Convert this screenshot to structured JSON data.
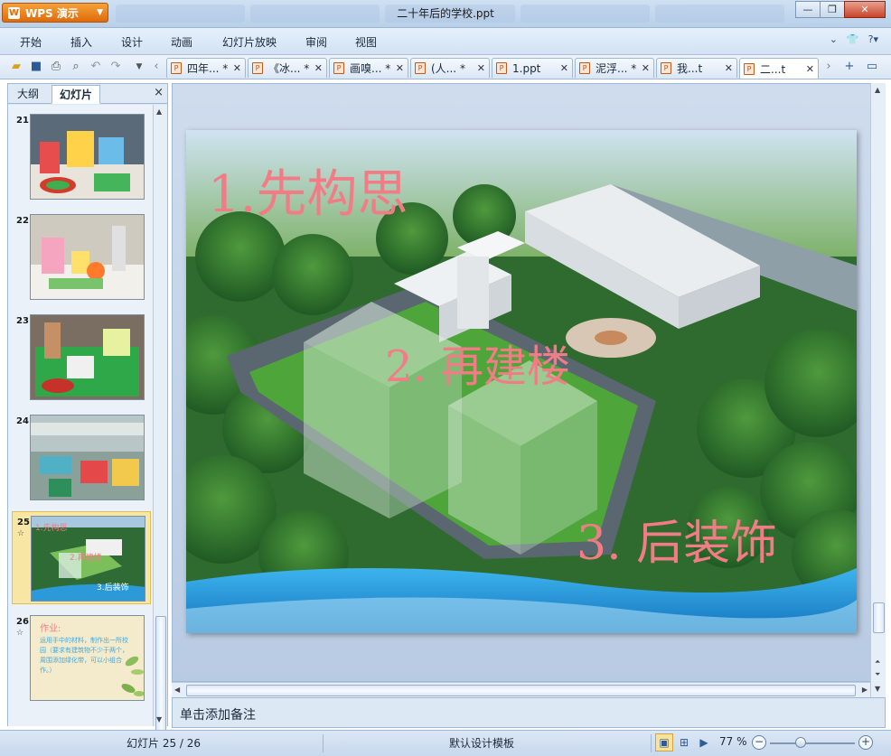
{
  "app": {
    "name": "WPS 演示",
    "window_title": "二十年后的学校.ppt"
  },
  "menu": [
    "开始",
    "插入",
    "设计",
    "动画",
    "幻灯片放映",
    "审阅",
    "视图"
  ],
  "menu_right_icons": [
    "chevron-down-icon",
    "shirt-icon",
    "help-icon"
  ],
  "toolbar_icons": [
    "open-folder-icon",
    "save-icon",
    "print-icon",
    "print-preview-icon",
    "undo-icon",
    "redo-icon",
    "customize-dropdown-icon",
    "tabs-scroll-left-icon"
  ],
  "doc_tabs": [
    {
      "label": "四年... *",
      "active": false
    },
    {
      "label": "《冰... *",
      "active": false
    },
    {
      "label": "画嗅... *",
      "active": false
    },
    {
      "label": "(人... *",
      "active": false
    },
    {
      "label": "1.ppt",
      "active": false
    },
    {
      "label": "泥浮... *",
      "active": false
    },
    {
      "label": "我...t",
      "active": false
    },
    {
      "label": "二...t",
      "active": true
    }
  ],
  "left_panel": {
    "tab_outline": "大纲",
    "tab_slides": "幻灯片",
    "close": "×"
  },
  "thumbnails": [
    {
      "number": "21",
      "has_animation": false
    },
    {
      "number": "22",
      "has_animation": false
    },
    {
      "number": "23",
      "has_animation": false
    },
    {
      "number": "24",
      "has_animation": false
    },
    {
      "number": "25",
      "has_animation": true,
      "texts": [
        "1.先构思",
        "2.再建楼",
        "3.后装饰"
      ]
    },
    {
      "number": "26",
      "has_animation": true,
      "heading": "作业:",
      "body": "运用手中的材料，制作出一所校园（要求有建筑物不少于两个，周围添加绿化带，可以小组合作。）"
    }
  ],
  "slide": {
    "step1": "1.先构思",
    "step2": "2. 再建楼",
    "step3": "3. 后装饰"
  },
  "notes_placeholder": "单击添加备注",
  "status": {
    "slide_counter": "幻灯片 25 / 26",
    "template": "默认设计模板",
    "zoom": "77 %"
  },
  "colors": {
    "slide_text": "#f27c86",
    "accent_orange": "#e87a1a",
    "chrome_blue": "#c7d8ed",
    "selected_thumb": "#f8e6a4"
  }
}
